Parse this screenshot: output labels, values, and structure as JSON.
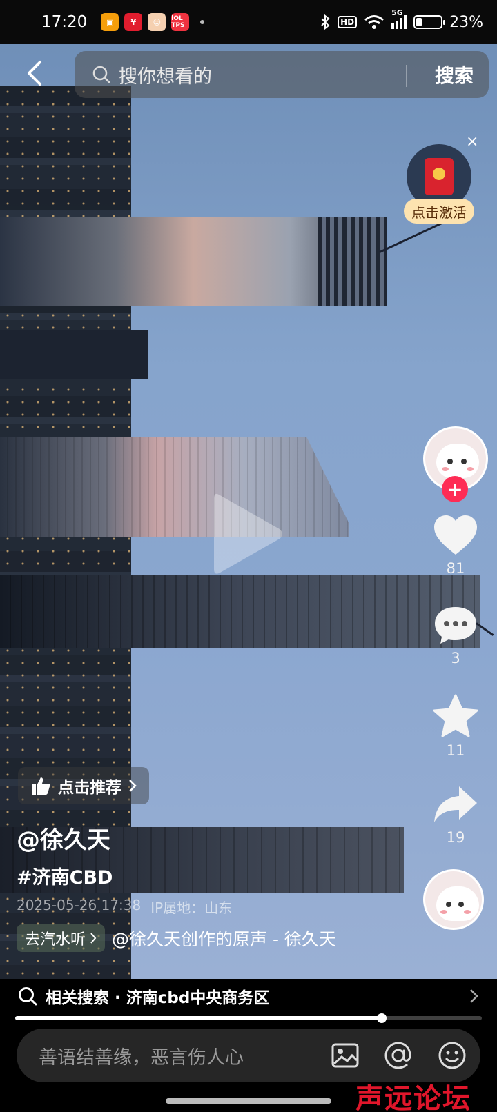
{
  "status_bar": {
    "time": "17:20",
    "battery_percent": "23%",
    "battery_level": 0.23,
    "network": "5G",
    "hd_label": "HD",
    "notification_icons": [
      "app-icon-1",
      "app-icon-2",
      "app-icon-3",
      "app-icon-4"
    ],
    "notif4_label": "lOL TPS"
  },
  "search": {
    "placeholder": "搜你想看的",
    "button_label": "搜索"
  },
  "red_packet": {
    "label": "点击激活",
    "close": "×"
  },
  "actions": {
    "likes": "81",
    "comments": "3",
    "favorites": "11",
    "shares": "19"
  },
  "video_info": {
    "recommend_label": "点击推荐",
    "author": "@徐久天",
    "hashtag": "#济南CBD",
    "date": "2025-05-26 17:38",
    "ip_location": "IP属地：山东",
    "music_chip": "去汽水听",
    "music_text": "@徐久天创作的原声 - 徐久天"
  },
  "related_search": {
    "label": "相关搜索 · 济南cbd中央商务区"
  },
  "progress": 0.785,
  "comment": {
    "placeholder": "善语结善缘，恶言伤人心"
  },
  "watermark": "声远论坛",
  "colors": {
    "follow_red": "#fe2c55",
    "watermark_red": "#e0162b"
  }
}
